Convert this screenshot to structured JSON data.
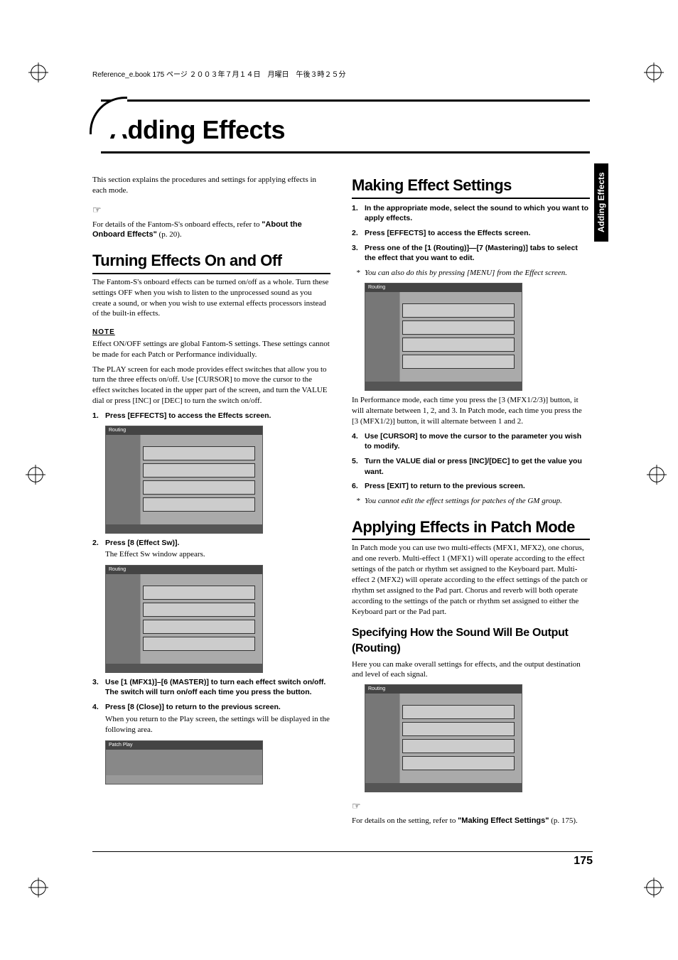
{
  "meta": {
    "crop_line": "Reference_e.book  175 ページ  ２００３年７月１４日　月曜日　午後３時２５分"
  },
  "title": "Adding Effects",
  "side_tab": "Adding Effects",
  "page_number": "175",
  "left": {
    "intro": "This section explains the procedures and settings for applying effects in each mode.",
    "hint1": "For details of the Fantom-S's onboard effects, refer to ",
    "hint1_ref": "\"About the Onboard Effects\"",
    "hint1_page": " (p. 20).",
    "h2_1": "Turning Effects On and Off",
    "p1": "The Fantom-S's onboard effects can be turned on/off as a whole. Turn these settings OFF when you wish to listen to the unprocessed sound as you create a sound, or when you wish to use external effects processors instead of the built-in effects.",
    "note_label": "NOTE",
    "note1": "Effect ON/OFF settings are global Fantom-S settings. These settings cannot be made for each Patch or Performance individually.",
    "p2": "The PLAY screen for each mode provides effect switches that allow you to turn the three effects on/off. Use [CURSOR] to move the cursor to the effect switches located in the upper part of the screen, and turn the VALUE dial or press [INC] or [DEC] to turn the switch on/off.",
    "step1": "Press [EFFECTS] to access the Effects screen.",
    "shot_label": "Routing",
    "step2": "Press [8 (Effect Sw)].",
    "step2_sub": "The Effect Sw window appears.",
    "step3": "Use [1 (MFX1)]–[6 (MASTER)] to turn each effect switch on/off. The switch will turn on/off each time you press the button.",
    "step4": "Press [8 (Close)] to return to the previous screen.",
    "step4_sub": "When you return to the Play screen, the settings will be displayed in the following area.",
    "shot3_label": "Patch Play"
  },
  "right": {
    "h2_1": "Making Effect Settings",
    "step1": "In the appropriate mode, select the sound to which you want to apply effects.",
    "step2": "Press [EFFECTS] to access the Effects screen.",
    "step3": "Press one of the [1 (Routing)]—[7 (Mastering)] tabs to select the effect that you want to edit.",
    "ital1": "You can also do this by pressing [MENU] from the Effect screen.",
    "shot_label": "Routing",
    "p1": "In Performance mode, each time you press the [3 (MFX1/2/3)] button, it will alternate between 1, 2, and 3. In Patch mode, each time you press the [3 (MFX1/2)] button, it will alternate between 1 and 2.",
    "step4": "Use [CURSOR] to move the cursor to the parameter you wish to modify.",
    "step5": "Turn the VALUE dial or press [INC]/[DEC] to get the value you want.",
    "step6": "Press [EXIT] to return to the previous screen.",
    "ital2": "You cannot edit the effect settings for patches of the GM group.",
    "h2_2": "Applying Effects in Patch Mode",
    "p2": "In Patch mode you can use two multi-effects (MFX1, MFX2), one chorus, and one reverb. Multi-effect 1 (MFX1) will operate according to the effect settings of the patch or rhythm set assigned to the Keyboard part. Multi-effect 2 (MFX2) will operate according to the effect settings of the patch or rhythm set assigned to the Pad part. Chorus and reverb will both operate according to the settings of the patch or rhythm set assigned to either the Keyboard part or the Pad part.",
    "h3_1": "Specifying How the Sound Will Be Output (Routing)",
    "p3": "Here you can make overall settings for effects, and the output destination and level of each signal.",
    "hint2": "For details on the setting, refer to ",
    "hint2_ref": "\"Making Effect Settings\"",
    "hint2_page": " (p. 175)."
  }
}
